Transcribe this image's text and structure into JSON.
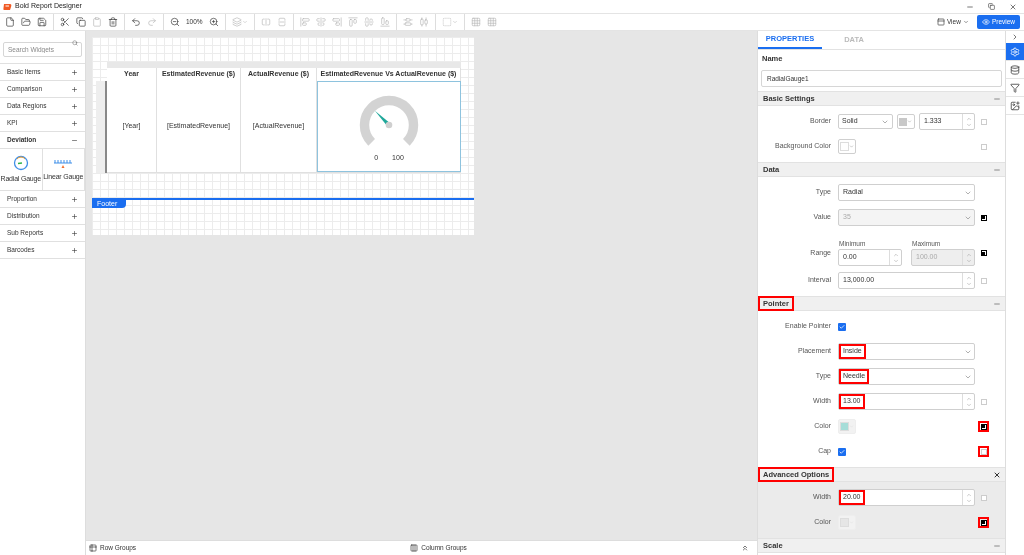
{
  "window": {
    "title": "Bold Report Designer"
  },
  "toolbar": {
    "zoom": "100%",
    "view": "View",
    "preview": "Preview"
  },
  "widgets": {
    "search_placeholder": "Search Widgets",
    "categories": [
      {
        "label": "Basic Items",
        "expanded": false
      },
      {
        "label": "Comparison",
        "expanded": false
      },
      {
        "label": "Data Regions",
        "expanded": false
      },
      {
        "label": "KPI",
        "expanded": false
      },
      {
        "label": "Deviation",
        "expanded": true,
        "items": [
          {
            "label": "Radial Gauge",
            "kind": "radial"
          },
          {
            "label": "Linear Gauge",
            "kind": "linear"
          }
        ]
      },
      {
        "label": "Proportion",
        "expanded": false
      },
      {
        "label": "Distribution",
        "expanded": false
      },
      {
        "label": "Sub Reports",
        "expanded": false
      },
      {
        "label": "Barcodes",
        "expanded": false
      }
    ]
  },
  "report": {
    "columns": [
      "Year",
      "EstimatedRevenue ($)",
      "ActualRevenue ($)",
      "EstimatedRevenue Vs ActualRevenue ($)"
    ],
    "row": [
      {
        "kind": "text",
        "text": "[Year]"
      },
      {
        "kind": "text",
        "text": "[EstimatedRevenue]"
      },
      {
        "kind": "text",
        "text": "[ActualRevenue]"
      },
      {
        "kind": "gauge",
        "min_label": "0",
        "max_label": "100",
        "selected": true
      }
    ],
    "footer": "Footer"
  },
  "properties": {
    "tabs": [
      {
        "label": "PROPERTIES",
        "selected": true
      },
      {
        "label": "DATA",
        "selected": false
      }
    ],
    "name_label": "Name",
    "name_value": "RadialGauge1",
    "sections": [
      {
        "title": "Basic Settings",
        "highlighted": false,
        "closable": false,
        "shaded": false,
        "rows": [
          {
            "kind": "border",
            "label": "Border",
            "value": "Solid",
            "color": "#c8c8c8",
            "number": "1.333",
            "reset": {
              "filled": false,
              "highlighted": false
            }
          },
          {
            "kind": "color",
            "label": "Background Color",
            "color": "#ffffff",
            "disabled": false,
            "reset": {
              "filled": false,
              "highlighted": false
            }
          }
        ]
      },
      {
        "title": "Data",
        "highlighted": false,
        "closable": false,
        "shaded": false,
        "rows": [
          {
            "kind": "select",
            "label": "Type",
            "value": "Radial",
            "disabled": false,
            "highlighted": false
          },
          {
            "kind": "select",
            "label": "Value",
            "value": "35",
            "disabled": true,
            "highlighted": false,
            "reset": {
              "filled": true,
              "highlighted": false
            }
          },
          {
            "kind": "range",
            "label": "Range",
            "min_label": "Minimum",
            "min": "0.00",
            "max_label": "Maximum",
            "max": "100.00",
            "max_disabled": true,
            "reset": {
              "filled": true,
              "highlighted": false
            }
          },
          {
            "kind": "spinner",
            "label": "Interval",
            "value": "13,000.00",
            "highlighted": false,
            "reset": {
              "filled": false,
              "highlighted": false
            }
          }
        ]
      },
      {
        "title": "Pointer",
        "highlighted": true,
        "closable": false,
        "shaded": false,
        "rows": [
          {
            "kind": "checkbox",
            "label": "Enable Pointer",
            "checked": true
          },
          {
            "kind": "select",
            "label": "Placement",
            "value": "Inside",
            "disabled": false,
            "highlighted": true
          },
          {
            "kind": "select",
            "label": "Type",
            "value": "Needle",
            "disabled": false,
            "highlighted": true
          },
          {
            "kind": "spinner",
            "label": "Width",
            "value": "13.00",
            "highlighted": true,
            "reset": {
              "filled": false,
              "highlighted": false
            }
          },
          {
            "kind": "color",
            "label": "Color",
            "color": "#a6ddd8",
            "disabled": true,
            "reset": {
              "filled": true,
              "highlighted": true
            }
          },
          {
            "kind": "checkbox",
            "label": "Cap",
            "checked": true,
            "reset": {
              "filled": false,
              "highlighted": true
            }
          }
        ]
      },
      {
        "title": "Advanced Options",
        "highlighted": true,
        "closable": true,
        "shaded": true,
        "rows": [
          {
            "kind": "spinner",
            "label": "Width",
            "value": "20.00",
            "highlighted": true,
            "reset": {
              "filled": false,
              "highlighted": false
            }
          },
          {
            "kind": "color",
            "label": "Color",
            "color": "#e6e6e6",
            "disabled": true,
            "reset": {
              "filled": true,
              "highlighted": true
            }
          }
        ]
      },
      {
        "title": "Scale",
        "highlighted": false,
        "closable": false
      }
    ]
  },
  "side_strip": [
    {
      "kind": "settings",
      "selected": true
    },
    {
      "kind": "data",
      "selected": false
    },
    {
      "kind": "filter",
      "selected": false
    },
    {
      "kind": "image",
      "selected": false
    }
  ],
  "bottom_bar": {
    "row_groups": "Row Groups",
    "column_groups": "Column Groups"
  }
}
